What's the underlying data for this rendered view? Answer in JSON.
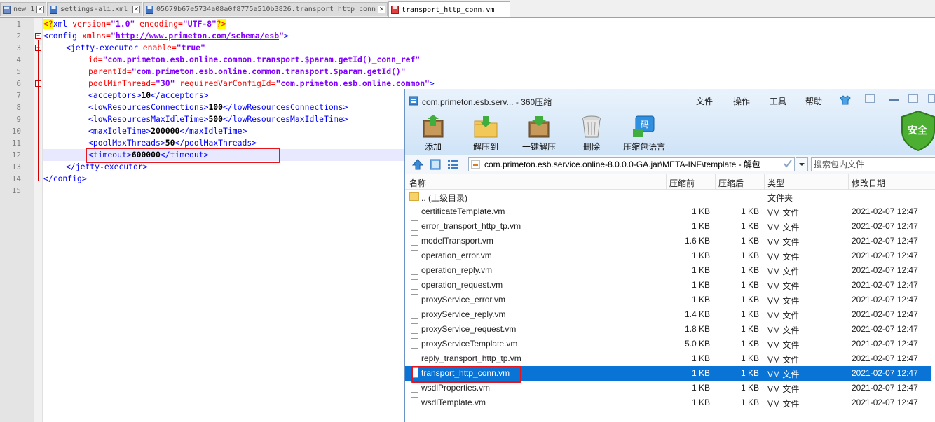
{
  "tabs": [
    {
      "label": "new 1",
      "icon": "notepad-file-icon",
      "active": false
    },
    {
      "label": "settings-ali.xml",
      "icon": "save-file-icon",
      "active": false
    },
    {
      "label": "05679b67e5734a08a0f8775a510b3826.transport_http_conn",
      "icon": "save-file-icon",
      "active": false
    },
    {
      "label": "transport_http_conn.vm",
      "icon": "red-file-icon",
      "active": true
    }
  ],
  "editor": {
    "line_numbers": [
      "1",
      "2",
      "3",
      "4",
      "5",
      "6",
      "7",
      "8",
      "9",
      "10",
      "11",
      "12",
      "13",
      "14",
      "15"
    ],
    "xml_decl": {
      "open": "<?",
      "name": "xml",
      "a1": " version=",
      "v1": "\"1.0\"",
      "a2": " encoding=",
      "v2": "\"UTF-8\"",
      "close": "?>"
    },
    "config_open": {
      "lt": "<",
      "tag": "config",
      "attr": " xmlns=",
      "q1": "\"",
      "url": "http://www.primeton.com/schema/esb",
      "q2": "\"",
      "gt": ">"
    },
    "jetty_open": {
      "lt": "<",
      "tag": "jetty-executor",
      "attr": " enable=",
      "val": "\"true\""
    },
    "id_line": {
      "attr": "id=",
      "val": "\"com.primeton.esb.online.common.transport.$param.getId()_conn_ref\""
    },
    "parent_line": {
      "attr": "parentId=",
      "val": "\"com.primeton.esb.online.common.transport.$param.getId()\""
    },
    "pool_line": {
      "attr": "poolMinThread=",
      "val": "\"30\"",
      "attr2": " requiredVarConfigId=",
      "val2": "\"com.primeton.esb.online.common\"",
      "gt": ">"
    },
    "params": [
      {
        "open": "<acceptors>",
        "value": "10",
        "close": "</acceptors>"
      },
      {
        "open": "<lowResourcesConnections>",
        "value": "100",
        "close": "</lowResourcesConnections>"
      },
      {
        "open": "<lowResourcesMaxIdleTime>",
        "value": "500",
        "close": "</lowResourcesMaxIdleTime>"
      },
      {
        "open": "<maxIdleTime>",
        "value": "200000",
        "close": "</maxIdleTime>"
      },
      {
        "open": "<poolMaxThreads>",
        "value": "50",
        "close": "</poolMaxThreads>"
      },
      {
        "open": "<timeout>",
        "value": "600000",
        "close": "</timeout>"
      }
    ],
    "jetty_close": "</jetty-executor>",
    "config_close": "</config>"
  },
  "zip": {
    "title": "com.primeton.esb.serv... - 360压缩",
    "menu": [
      "文件",
      "操作",
      "工具",
      "帮助"
    ],
    "toolbar": [
      {
        "label": "添加",
        "icon": "add-archive-icon"
      },
      {
        "label": "解压到",
        "icon": "extract-to-icon"
      },
      {
        "label": "一键解压",
        "icon": "one-click-extract-icon"
      },
      {
        "label": "删除",
        "icon": "delete-trash-icon"
      },
      {
        "label": "压缩包语言",
        "icon": "archive-language-icon"
      }
    ],
    "badge": "安全",
    "path": "com.primeton.esb.service.online-8.0.0.0-GA.jar\\META-INF\\template - 解包",
    "search_placeholder": "搜索包内文件",
    "columns": {
      "name": "名称",
      "before": "压缩前",
      "after": "压缩后",
      "type": "类型",
      "date": "修改日期"
    },
    "parent_row": {
      "name": ".. (上级目录)",
      "type": "文件夹"
    },
    "files": [
      {
        "name": "certificateTemplate.vm",
        "before": "1 KB",
        "after": "1 KB",
        "type": "VM 文件",
        "date": "2021-02-07 12:47"
      },
      {
        "name": "error_transport_http_tp.vm",
        "before": "1 KB",
        "after": "1 KB",
        "type": "VM 文件",
        "date": "2021-02-07 12:47"
      },
      {
        "name": "modelTransport.vm",
        "before": "1.6 KB",
        "after": "1 KB",
        "type": "VM 文件",
        "date": "2021-02-07 12:47"
      },
      {
        "name": "operation_error.vm",
        "before": "1 KB",
        "after": "1 KB",
        "type": "VM 文件",
        "date": "2021-02-07 12:47"
      },
      {
        "name": "operation_reply.vm",
        "before": "1 KB",
        "after": "1 KB",
        "type": "VM 文件",
        "date": "2021-02-07 12:47"
      },
      {
        "name": "operation_request.vm",
        "before": "1 KB",
        "after": "1 KB",
        "type": "VM 文件",
        "date": "2021-02-07 12:47"
      },
      {
        "name": "proxyService_error.vm",
        "before": "1 KB",
        "after": "1 KB",
        "type": "VM 文件",
        "date": "2021-02-07 12:47"
      },
      {
        "name": "proxyService_reply.vm",
        "before": "1.4 KB",
        "after": "1 KB",
        "type": "VM 文件",
        "date": "2021-02-07 12:47"
      },
      {
        "name": "proxyService_request.vm",
        "before": "1.8 KB",
        "after": "1 KB",
        "type": "VM 文件",
        "date": "2021-02-07 12:47"
      },
      {
        "name": "proxyServiceTemplate.vm",
        "before": "5.0 KB",
        "after": "1 KB",
        "type": "VM 文件",
        "date": "2021-02-07 12:47"
      },
      {
        "name": "reply_transport_http_tp.vm",
        "before": "1 KB",
        "after": "1 KB",
        "type": "VM 文件",
        "date": "2021-02-07 12:47"
      },
      {
        "name": "transport_http_conn.vm",
        "before": "1 KB",
        "after": "1 KB",
        "type": "VM 文件",
        "date": "2021-02-07 12:47",
        "selected": true
      },
      {
        "name": "wsdlProperties.vm",
        "before": "1 KB",
        "after": "1 KB",
        "type": "VM 文件",
        "date": "2021-02-07 12:47"
      },
      {
        "name": "wsdlTemplate.vm",
        "before": "1 KB",
        "after": "1 KB",
        "type": "VM 文件",
        "date": "2021-02-07 12:47"
      }
    ],
    "colors": {
      "selection": "#0a73d6",
      "highlight_box": "#e8141c"
    }
  }
}
